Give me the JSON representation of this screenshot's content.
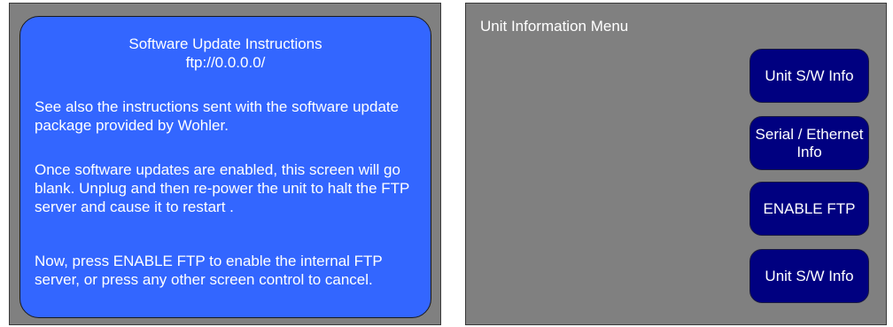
{
  "instructions": {
    "title": "Software Update Instructions",
    "url": "ftp://0.0.0.0/",
    "paragraph_1": "See also the instructions sent with the software update package provided by Wohler.",
    "paragraph_2": "Once software updates are enabled, this screen will go blank.  Unplug and then re-power the unit to halt the FTP server and cause it to restart .",
    "paragraph_3": "Now, press ENABLE FTP to enable the internal FTP server, or press any other screen control to cancel."
  },
  "menu": {
    "title": "Unit Information Menu",
    "buttons": [
      {
        "label": "Unit S/W Info"
      },
      {
        "label": "Serial / Ethernet Info"
      },
      {
        "label": "ENABLE FTP"
      },
      {
        "label": "Unit S/W Info"
      }
    ]
  },
  "colors": {
    "panel_background": "#808080",
    "instructions_background": "#3366ff",
    "button_background": "#000080",
    "text": "#ffffff"
  }
}
